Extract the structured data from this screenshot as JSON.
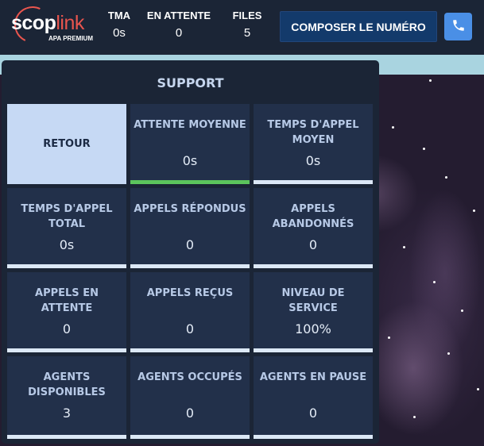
{
  "brand": {
    "name_part1": "scop",
    "name_part2": "link",
    "subtitle": "APA PREMIUM"
  },
  "header_stats": [
    {
      "label": "TMA",
      "value": "0s"
    },
    {
      "label": "EN ATTENTE",
      "value": "0"
    },
    {
      "label": "FILES",
      "value": "5"
    }
  ],
  "actions": {
    "compose_label": "COMPOSER LE NUMÉRO",
    "phone_icon": "phone-icon"
  },
  "panel": {
    "title": "SUPPORT",
    "back_label": "RETOUR",
    "tiles": [
      {
        "label": "ATTENTE MOYENNE",
        "value": "0s",
        "bar_color": "#5cc45c"
      },
      {
        "label": "TEMPS D'APPEL MOYEN",
        "value": "0s"
      },
      {
        "label": "TEMPS D'APPEL TOTAL",
        "value": "0s"
      },
      {
        "label": "APPELS RÉPONDUS",
        "value": "0"
      },
      {
        "label": "APPELS ABANDONNÉS",
        "value": "0"
      },
      {
        "label": "APPELS EN ATTENTE",
        "value": "0"
      },
      {
        "label": "APPELS REÇUS",
        "value": "0"
      },
      {
        "label": "NIVEAU DE SERVICE",
        "value": "100%"
      },
      {
        "label": "AGENTS DISPONIBLES",
        "value": "3"
      },
      {
        "label": "AGENTS OCCUPÉS",
        "value": "0"
      },
      {
        "label": "AGENTS EN PAUSE",
        "value": "0"
      }
    ]
  },
  "colors": {
    "background": "#1b2536",
    "tile": "#22304a",
    "back_tile": "#c6d9f4",
    "compose_button": "#133a6b",
    "phone_button": "#4a8fe6",
    "brand_accent": "#e8554e"
  }
}
